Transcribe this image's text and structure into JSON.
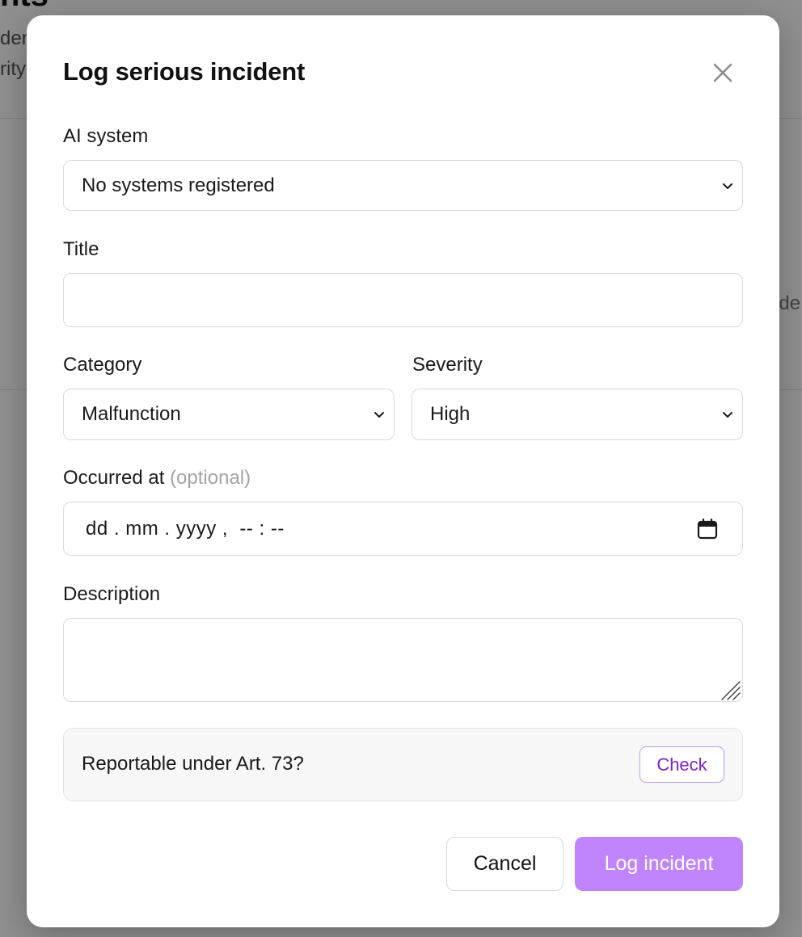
{
  "background": {
    "title": "nts",
    "subtitle_line1": "den",
    "subtitle_line2": "rity",
    "right_fragment": "nde"
  },
  "modal": {
    "title": "Log serious incident",
    "close_icon": "close-icon",
    "ai_system": {
      "label": "AI system",
      "value": "No systems registered"
    },
    "title_field": {
      "label": "Title",
      "value": ""
    },
    "category": {
      "label": "Category",
      "value": "Malfunction"
    },
    "severity": {
      "label": "Severity",
      "value": "High"
    },
    "occurred_at": {
      "label": "Occurred at",
      "optional": "(optional)",
      "placeholder": "dd . mm . yyyy ,  -- : --",
      "icon": "calendar-icon"
    },
    "description": {
      "label": "Description",
      "value": ""
    },
    "reportable": {
      "question": "Reportable under Art. 73?",
      "check_label": "Check"
    },
    "footer": {
      "cancel_label": "Cancel",
      "submit_label": "Log incident"
    }
  },
  "colors": {
    "primary": "#c084fc",
    "check_text": "#7e22ce",
    "check_border": "#b69aef"
  }
}
